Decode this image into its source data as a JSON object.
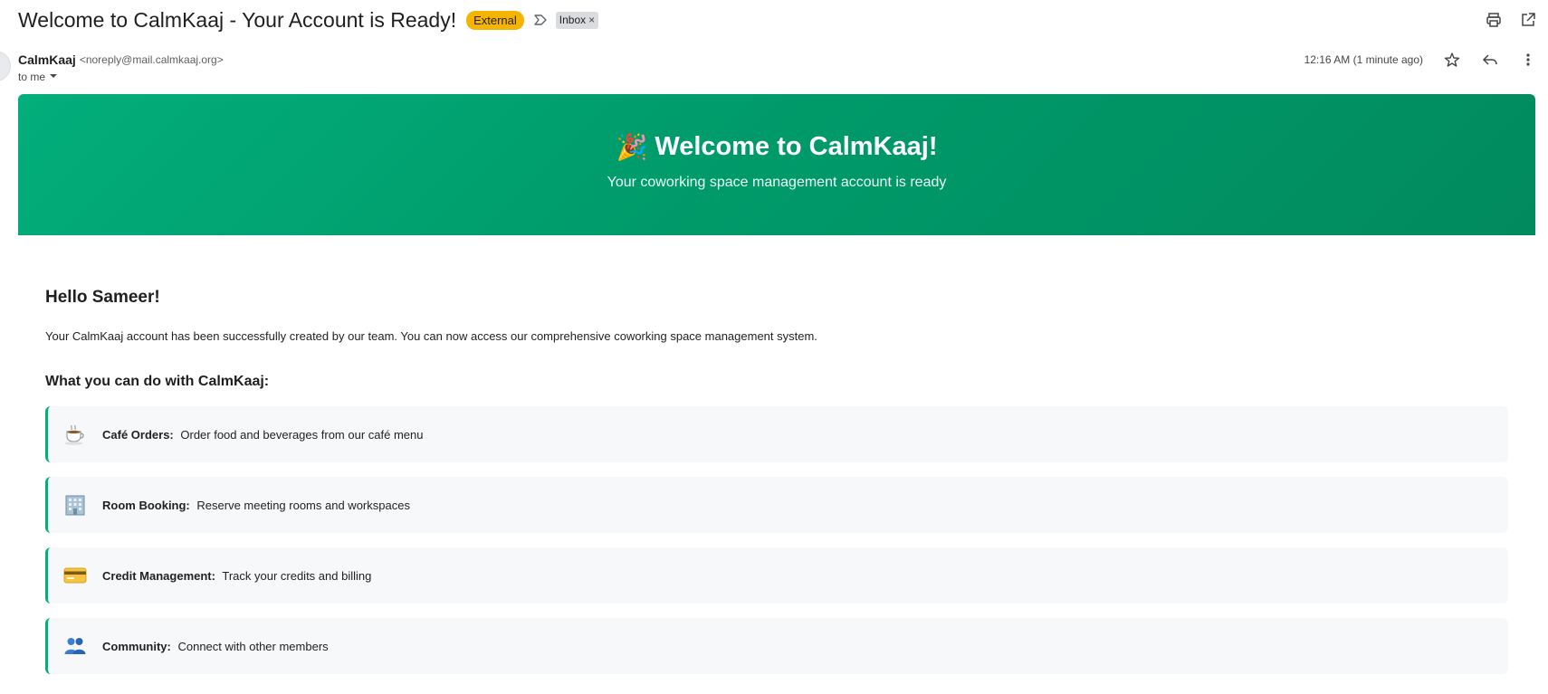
{
  "email": {
    "subject": "Welcome to CalmKaaj - Your Account is Ready!",
    "external_badge": "External",
    "label_chip": "Inbox",
    "label_chip_remove": "×",
    "sender_name": "CalmKaaj",
    "sender_email": "<noreply@mail.calmkaaj.org>",
    "timestamp": "12:16 AM (1 minute ago)",
    "recipient": "to me"
  },
  "icons": {
    "label": "label-outline-icon",
    "print": "print-icon",
    "open_new_window": "open-in-new-window-icon",
    "star": "star-icon",
    "reply": "reply-icon",
    "more": "more-vertical-icon",
    "recipient_dropdown": "caret-down-icon"
  },
  "hero": {
    "emoji": "🎉",
    "title": "Welcome to CalmKaaj!",
    "subtitle": "Your coworking space management account is ready"
  },
  "body": {
    "greeting": "Hello Sameer!",
    "intro": "Your CalmKaaj account has been successfully created by our team. You can now access our comprehensive coworking space management system.",
    "section_heading": "What you can do with CalmKaaj:",
    "features": [
      {
        "icon": "coffee-icon",
        "title": "Café Orders:",
        "description": "Order food and beverages from our café menu"
      },
      {
        "icon": "building-icon",
        "title": "Room Booking:",
        "description": "Reserve meeting rooms and workspaces"
      },
      {
        "icon": "credit-card-icon",
        "title": "Credit Management:",
        "description": "Track your credits and billing"
      },
      {
        "icon": "people-icon",
        "title": "Community:",
        "description": "Connect with other members"
      }
    ]
  },
  "colors": {
    "brand_green": "#02ae7b",
    "brand_green_dark": "#018a5e",
    "external_badge": "#f4b400",
    "feature_bg": "#f7f8f9"
  }
}
